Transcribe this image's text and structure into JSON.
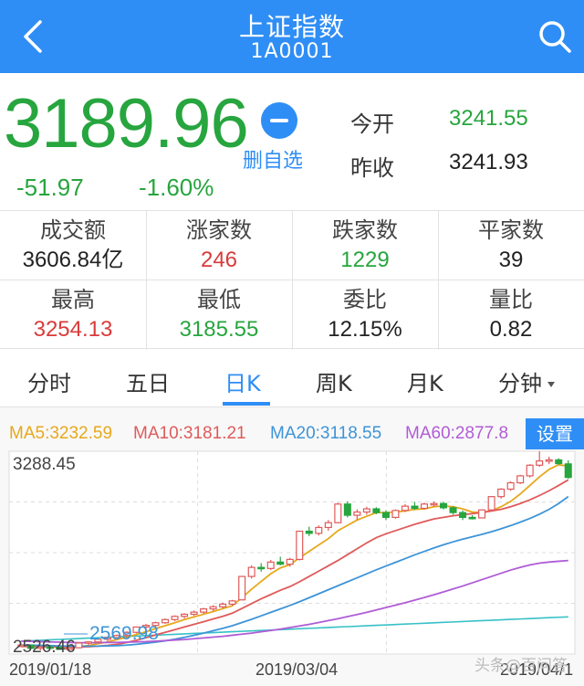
{
  "header": {
    "title": "上证指数",
    "code": "1A0001"
  },
  "quote": {
    "price": "3189.96",
    "change": "-51.97",
    "change_pct": "-1.60%",
    "delete_watch_label": "删自选",
    "open_label": "今开",
    "open_value": "3241.55",
    "prev_close_label": "昨收",
    "prev_close_value": "3241.93"
  },
  "stats": [
    {
      "label": "成交额",
      "value": "3606.84亿",
      "color": "#222222"
    },
    {
      "label": "涨家数",
      "value": "246",
      "color": "#d93b3b"
    },
    {
      "label": "跌家数",
      "value": "1229",
      "color": "#27a53e"
    },
    {
      "label": "平家数",
      "value": "39",
      "color": "#222222"
    },
    {
      "label": "最高",
      "value": "3254.13",
      "color": "#d93b3b"
    },
    {
      "label": "最低",
      "value": "3185.55",
      "color": "#27a53e"
    },
    {
      "label": "委比",
      "value": "12.15%",
      "color": "#222222"
    },
    {
      "label": "量比",
      "value": "0.82",
      "color": "#222222"
    }
  ],
  "tabs": [
    "分时",
    "五日",
    "日K",
    "周K",
    "月K",
    "分钟"
  ],
  "active_tab": "日K",
  "chart": {
    "ma_labels": [
      {
        "text": "MA5:3232.59",
        "color": "#e7a81b"
      },
      {
        "text": "MA10:3181.21",
        "color": "#e05a5a"
      },
      {
        "text": "MA20:3118.55",
        "color": "#3d94d8"
      },
      {
        "text": "MA60:2877.8",
        "color": "#b05cd6"
      }
    ],
    "settings_label": "设置",
    "y_high": "3288.45",
    "y_low": "2526.46",
    "min_marker": "2569.98",
    "dates": [
      "2019/01/18",
      "2019/03/04",
      "2019/04/1"
    ],
    "up_color": "#e05a5a",
    "down_color": "#27a53e",
    "watermark": "头条@百问答"
  },
  "chart_data": {
    "type": "candlestick",
    "ylim": [
      2526.46,
      3288.45
    ],
    "x": [
      "2019/01/18",
      "2019/03/04",
      "2019/04/1"
    ],
    "ohlc": [
      [
        2559,
        2565,
        2552,
        2560
      ],
      [
        2560,
        2562,
        2545,
        2548
      ],
      [
        2548,
        2556,
        2540,
        2553
      ],
      [
        2553,
        2560,
        2548,
        2552
      ],
      [
        2552,
        2555,
        2542,
        2544
      ],
      [
        2544,
        2552,
        2538,
        2550
      ],
      [
        2550,
        2570,
        2548,
        2568
      ],
      [
        2568,
        2575,
        2560,
        2572
      ],
      [
        2572,
        2585,
        2568,
        2582
      ],
      [
        2582,
        2590,
        2575,
        2588
      ],
      [
        2588,
        2600,
        2582,
        2596
      ],
      [
        2596,
        2612,
        2590,
        2608
      ],
      [
        2608,
        2630,
        2604,
        2628
      ],
      [
        2628,
        2640,
        2620,
        2634
      ],
      [
        2634,
        2648,
        2628,
        2644
      ],
      [
        2644,
        2660,
        2640,
        2656
      ],
      [
        2656,
        2672,
        2650,
        2668
      ],
      [
        2668,
        2680,
        2660,
        2676
      ],
      [
        2676,
        2690,
        2670,
        2684
      ],
      [
        2684,
        2700,
        2678,
        2696
      ],
      [
        2696,
        2710,
        2688,
        2704
      ],
      [
        2704,
        2720,
        2698,
        2714
      ],
      [
        2714,
        2730,
        2708,
        2726
      ],
      [
        2730,
        2820,
        2728,
        2818
      ],
      [
        2818,
        2860,
        2810,
        2852
      ],
      [
        2852,
        2868,
        2836,
        2848
      ],
      [
        2848,
        2880,
        2842,
        2872
      ],
      [
        2872,
        2892,
        2860,
        2864
      ],
      [
        2864,
        2888,
        2855,
        2882
      ],
      [
        2882,
        2990,
        2878,
        2988
      ],
      [
        2988,
        3005,
        2970,
        2980
      ],
      [
        2980,
        3010,
        2972,
        3002
      ],
      [
        3002,
        3030,
        2990,
        3020
      ],
      [
        3020,
        3095,
        3018,
        3090
      ],
      [
        3090,
        3100,
        3040,
        3048
      ],
      [
        3048,
        3070,
        3030,
        3060
      ],
      [
        3060,
        3080,
        3050,
        3072
      ],
      [
        3072,
        3078,
        3052,
        3058
      ],
      [
        3058,
        3066,
        3030,
        3040
      ],
      [
        3040,
        3070,
        3035,
        3066
      ],
      [
        3066,
        3090,
        3060,
        3082
      ],
      [
        3082,
        3098,
        3068,
        3074
      ],
      [
        3074,
        3095,
        3070,
        3090
      ],
      [
        3090,
        3100,
        3080,
        3092
      ],
      [
        3092,
        3098,
        3070,
        3076
      ],
      [
        3076,
        3082,
        3050,
        3058
      ],
      [
        3058,
        3066,
        3030,
        3040
      ],
      [
        3040,
        3048,
        3032,
        3038
      ],
      [
        3038,
        3070,
        3036,
        3068
      ],
      [
        3068,
        3120,
        3066,
        3118
      ],
      [
        3118,
        3150,
        3110,
        3146
      ],
      [
        3146,
        3175,
        3140,
        3170
      ],
      [
        3170,
        3200,
        3165,
        3196
      ],
      [
        3196,
        3240,
        3190,
        3236
      ],
      [
        3236,
        3288,
        3230,
        3252
      ],
      [
        3252,
        3268,
        3240,
        3256
      ],
      [
        3256,
        3262,
        3238,
        3242
      ],
      [
        3241,
        3254,
        3185,
        3190
      ]
    ],
    "series": [
      {
        "name": "MA5",
        "color": "#e7a81b",
        "values": [
          2555,
          2556,
          2554,
          2553,
          2552,
          2551,
          2555,
          2558,
          2565,
          2572,
          2581,
          2590,
          2600,
          2610,
          2622,
          2633,
          2644,
          2656,
          2666,
          2676,
          2686,
          2697,
          2708,
          2738,
          2770,
          2799,
          2828,
          2850,
          2862,
          2888,
          2912,
          2936,
          2960,
          2990,
          3010,
          3030,
          3044,
          3058,
          3058,
          3060,
          3064,
          3070,
          3072,
          3080,
          3083,
          3080,
          3072,
          3060,
          3058,
          3065,
          3080,
          3100,
          3128,
          3160,
          3192,
          3220,
          3238,
          3232
        ]
      },
      {
        "name": "MA10",
        "color": "#e05a5a",
        "values": [
          2555,
          2555,
          2554,
          2554,
          2553,
          2553,
          2553,
          2554,
          2556,
          2559,
          2563,
          2570,
          2578,
          2588,
          2598,
          2608,
          2618,
          2628,
          2638,
          2648,
          2658,
          2668,
          2680,
          2698,
          2716,
          2734,
          2750,
          2766,
          2780,
          2798,
          2818,
          2838,
          2858,
          2878,
          2900,
          2922,
          2944,
          2964,
          2978,
          2990,
          3002,
          3014,
          3024,
          3034,
          3040,
          3046,
          3050,
          3054,
          3058,
          3064,
          3070,
          3080,
          3092,
          3106,
          3122,
          3140,
          3160,
          3181
        ]
      },
      {
        "name": "MA20",
        "color": "#3d94d8",
        "values": [
          2560,
          2560,
          2559,
          2558,
          2557,
          2556,
          2556,
          2556,
          2556,
          2557,
          2558,
          2560,
          2563,
          2567,
          2571,
          2576,
          2582,
          2589,
          2597,
          2605,
          2614,
          2623,
          2633,
          2645,
          2657,
          2670,
          2683,
          2696,
          2709,
          2723,
          2738,
          2753,
          2768,
          2783,
          2798,
          2813,
          2828,
          2843,
          2857,
          2871,
          2885,
          2899,
          2912,
          2925,
          2937,
          2948,
          2958,
          2967,
          2976,
          2986,
          2997,
          3009,
          3022,
          3036,
          3052,
          3070,
          3092,
          3118
        ]
      },
      {
        "name": "MA60",
        "color": "#b05cd6",
        "values": [
          2575,
          2574,
          2573,
          2572,
          2571,
          2570,
          2569,
          2569,
          2569,
          2570,
          2570,
          2571,
          2572,
          2573,
          2575,
          2577,
          2579,
          2581,
          2584,
          2587,
          2590,
          2593,
          2597,
          2601,
          2605,
          2610,
          2615,
          2620,
          2626,
          2632,
          2638,
          2645,
          2652,
          2659,
          2667,
          2675,
          2683,
          2692,
          2701,
          2710,
          2719,
          2729,
          2739,
          2749,
          2760,
          2771,
          2782,
          2794,
          2806,
          2818,
          2830,
          2842,
          2852,
          2861,
          2868,
          2872,
          2875,
          2877.8
        ]
      }
    ],
    "extra_line": {
      "color": "#37c1c6"
    }
  }
}
